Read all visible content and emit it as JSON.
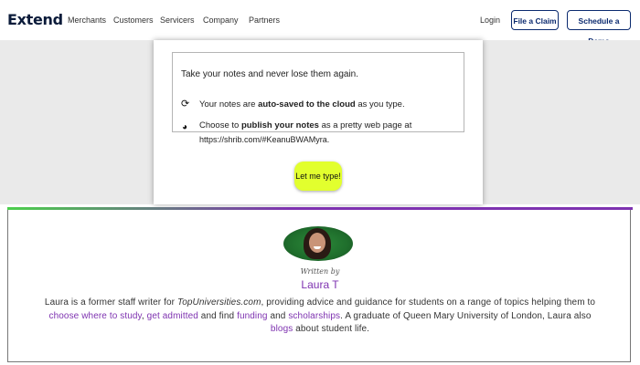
{
  "nav": {
    "logo": "Extend",
    "links": [
      "Merchants",
      "Customers",
      "Servicers",
      "Company",
      "Partners"
    ],
    "login": "Login",
    "file_claim": "File a Claim",
    "schedule_demo": "Schedule a Demo"
  },
  "promo": {
    "intro": "Take your notes and never lose them again.",
    "feature1": {
      "pre": "Your notes are ",
      "bold": "auto-saved to the cloud",
      "post": " as you type."
    },
    "feature2": {
      "pre": "Choose to ",
      "bold": "publish your notes",
      "post": " as a pretty web page at"
    },
    "url": "https://shrib.com/#KeanuBWAMyra.",
    "cta": "Let me type!"
  },
  "author": {
    "written_by": "Written by",
    "name": "Laura T",
    "bio": {
      "s1": "Laura is a former staff writer for ",
      "site": "TopUniversities.com",
      "s2": ", providing advice and guidance for students on a range of topics helping them to ",
      "link1": "choose where to study",
      "s3": ", ",
      "link2": "get admitted",
      "s4": " and find ",
      "link3": "funding",
      "s5": " and ",
      "link4": "scholarships",
      "s6": ". A graduate of Queen Mary University of London, Laura also ",
      "link5": "blogs",
      "s7": " about student life."
    }
  },
  "colors": {
    "accent": "#7e32b0",
    "nav_button": "#0b2a6f",
    "cta": "#e2ff2e",
    "avatar_bg": "#2c8a3a"
  },
  "icons": {
    "feature1": "sync-icon",
    "feature2": "publish-icon"
  }
}
